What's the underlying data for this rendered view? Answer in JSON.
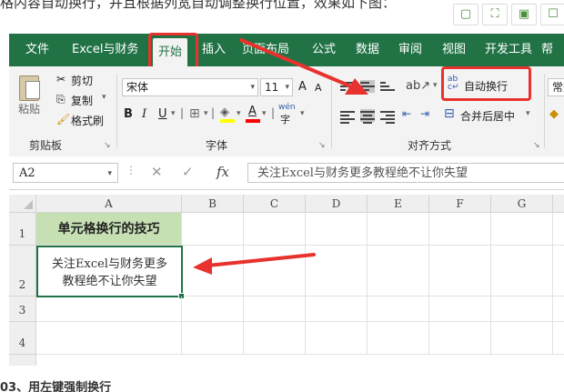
{
  "article": {
    "top_text": "格内容自动换行，并且根据列宽自动调整换行位置，效果如下图：",
    "bottom_text": "03、用左键强制换行"
  },
  "page_toolbar": [
    "▢",
    "⛶",
    "▣",
    "☐"
  ],
  "ribbon_tabs": [
    "文件",
    "Excel与财务",
    "开始",
    "插入",
    "页面布局",
    "公式",
    "数据",
    "审阅",
    "视图",
    "开发工具",
    "帮"
  ],
  "active_tab": "开始",
  "clipboard": {
    "paste": "粘贴",
    "cut": "剪切",
    "copy": "复制",
    "format_painter": "格式刷",
    "group_label": "剪贴板"
  },
  "font": {
    "name": "宋体",
    "size": "11",
    "grow": "A",
    "shrink": "A",
    "bold": "B",
    "italic": "I",
    "underline": "U",
    "font_color_letter": "A",
    "phonetic": "wén",
    "group_label": "字体"
  },
  "alignment": {
    "wrap_text": "自动换行",
    "merge_center": "合并后居中",
    "group_label": "对齐方式"
  },
  "number": {
    "format": "常规"
  },
  "formula_bar": {
    "cell_ref": "A2",
    "fx": "fx",
    "cancel": "✕",
    "confirm": "✓",
    "content": "关注Excel与财务更多教程绝不让你失望"
  },
  "sheet": {
    "columns": [
      "A",
      "B",
      "C",
      "D",
      "E",
      "F",
      "G"
    ],
    "rows": [
      "1",
      "2",
      "3",
      "4"
    ],
    "a1": "单元格换行的技巧",
    "a2_line1": "关注Excel与财务更多",
    "a2_line2": "教程绝不让你失望"
  },
  "colors": {
    "excel_green": "#217346",
    "header_fill": "#c6e0b4",
    "highlight_red": "#e8322d",
    "selection_border": "#217346"
  }
}
